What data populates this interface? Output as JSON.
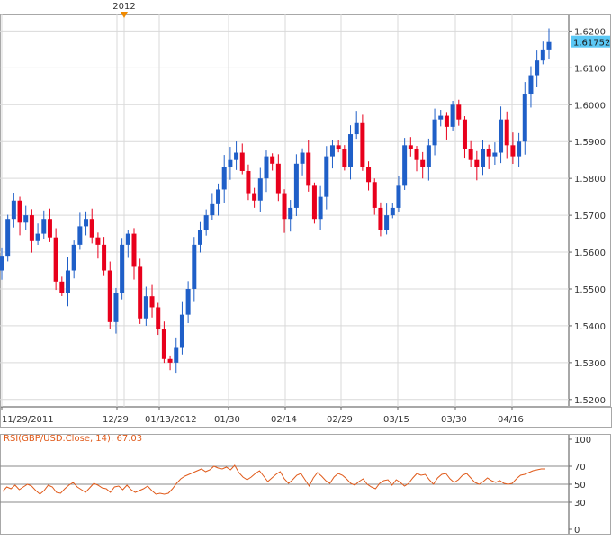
{
  "colors": {
    "up": "#1f5fc8",
    "down": "#e8001c",
    "rsi_line": "#e05a1a",
    "grid": "#d9d9d9",
    "axis_text": "#333333",
    "last_price_tag": "#5bc8f5",
    "marker": "#f08a00"
  },
  "chart_data": [
    {
      "type": "candlestick",
      "title": "",
      "marker_label": "2012",
      "last_price_label": "1.61752",
      "ylim": [
        1.518,
        1.6245
      ],
      "y_ticks": [
        "1.6200",
        "1.6100",
        "1.6000",
        "1.5900",
        "1.5800",
        "1.5700",
        "1.5600",
        "1.5500",
        "1.5400",
        "1.5300",
        "1.5200"
      ],
      "x_ticks": [
        "11/29/2011",
        "12/29",
        "01/13/2012",
        "01/30",
        "02/14",
        "02/29",
        "03/15",
        "03/30",
        "04/16"
      ],
      "ohlc_close_path": [
        1.559,
        1.569,
        1.574,
        1.568,
        1.57,
        1.563,
        1.565,
        1.569,
        1.564,
        1.552,
        1.549,
        1.555,
        1.562,
        1.567,
        1.569,
        1.564,
        1.562,
        1.555,
        1.541,
        1.549,
        1.562,
        1.565,
        1.556,
        1.542,
        1.548,
        1.545,
        1.539,
        1.531,
        1.53,
        1.534,
        1.543,
        1.55,
        1.562,
        1.566,
        1.57,
        1.573,
        1.577,
        1.583,
        1.585,
        1.587,
        1.582,
        1.576,
        1.574,
        1.58,
        1.586,
        1.584,
        1.576,
        1.569,
        1.572,
        1.584,
        1.587,
        1.578,
        1.569,
        1.575,
        1.586,
        1.589,
        1.588,
        1.583,
        1.592,
        1.595,
        1.583,
        1.579,
        1.572,
        1.566,
        1.57,
        1.572,
        1.578,
        1.589,
        1.588,
        1.585,
        1.583,
        1.589,
        1.596,
        1.597,
        1.594,
        1.6,
        1.596,
        1.588,
        1.585,
        1.583,
        1.588,
        1.586,
        1.587,
        1.596,
        1.589,
        1.586,
        1.59,
        1.603,
        1.608,
        1.612,
        1.615,
        1.617
      ]
    },
    {
      "type": "line",
      "title": "RSI(GBP/USD.Close, 14): 67.03",
      "ylim": [
        0,
        100
      ],
      "y_ticks": [
        "100",
        "70",
        "50",
        "30",
        "0"
      ],
      "reference_lines": [
        70,
        50,
        30
      ],
      "series": [
        {
          "name": "",
          "values": [
            42,
            47,
            45,
            49,
            44,
            47,
            50,
            48,
            43,
            39,
            43,
            49,
            47,
            41,
            40,
            45,
            49,
            52,
            47,
            44,
            41,
            46,
            51,
            49,
            46,
            45,
            41,
            47,
            48,
            44,
            49,
            44,
            41,
            43,
            45,
            48,
            43,
            39,
            40,
            39,
            40,
            45,
            51,
            56,
            59,
            61,
            63,
            65,
            67,
            64,
            66,
            70,
            68,
            67,
            69,
            66,
            71,
            63,
            58,
            55,
            58,
            62,
            65,
            59,
            53,
            57,
            61,
            64,
            56,
            51,
            55,
            60,
            62,
            55,
            48,
            57,
            63,
            59,
            54,
            51,
            58,
            62,
            60,
            56,
            51,
            49,
            53,
            56,
            50,
            47,
            45,
            51,
            54,
            55,
            49,
            55,
            52,
            48,
            51,
            57,
            62,
            60,
            61,
            55,
            50,
            57,
            61,
            62,
            56,
            52,
            55,
            60,
            62,
            57,
            52,
            50,
            53,
            57,
            54,
            52,
            54,
            51,
            50,
            51,
            56,
            60,
            61,
            63,
            65,
            66,
            67,
            67
          ]
        }
      ]
    }
  ]
}
